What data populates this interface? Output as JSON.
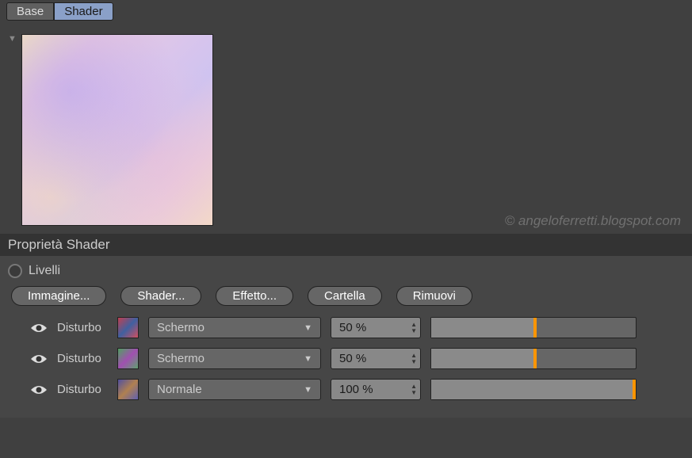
{
  "tabs": {
    "base": "Base",
    "shader": "Shader"
  },
  "watermark": "© angeloferretti.blogspot.com",
  "section_title": "Proprietà Shader",
  "levels_label": "Livelli",
  "buttons": {
    "image": "Immagine...",
    "shader": "Shader...",
    "effect": "Effetto...",
    "folder": "Cartella",
    "remove": "Rimuovi"
  },
  "layers": [
    {
      "name": "Disturbo",
      "blend": "Schermo",
      "percent": "50 %",
      "fill": 50
    },
    {
      "name": "Disturbo",
      "blend": "Schermo",
      "percent": "50 %",
      "fill": 50
    },
    {
      "name": "Disturbo",
      "blend": "Normale",
      "percent": "100 %",
      "fill": 100
    }
  ]
}
